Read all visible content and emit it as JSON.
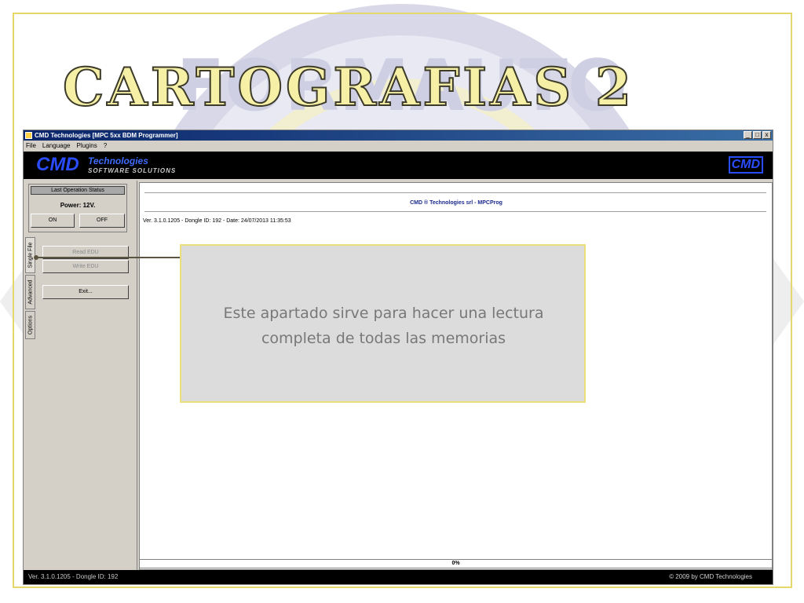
{
  "slide": {
    "title": "CARTOGRAFIAS 2",
    "watermark_text": "FORMAUTO"
  },
  "window": {
    "title": "CMD Technologies [MPC 5xx BDM Programmer]",
    "controls": [
      "_",
      "□",
      "x"
    ]
  },
  "menu": {
    "items": [
      "File",
      "Language",
      "Plugins",
      "?"
    ]
  },
  "banner": {
    "brand": "CMD",
    "technologies": "Technologies",
    "tagline": "SOFTWARE SOLUTIONS",
    "logo_right": "CMD"
  },
  "left_panel": {
    "status_label": "Last Operation Status",
    "power_label": "Power: 12V.",
    "on_button": "ON",
    "off_button": "OFF",
    "tabs": [
      "Single File",
      "Advanced",
      "Options"
    ],
    "read_button": "Read EDU",
    "write_button": "Write EDU",
    "exit_button": "Exit..."
  },
  "main": {
    "header": "CMD ® Technologies srl - MPCProg",
    "version_line": "Ver. 3.1.0.1205 - Dongle ID: 192 - Date: 24/07/2013 11:35:53"
  },
  "progress": {
    "label": "0%",
    "value": 0
  },
  "statusbar": {
    "left": "Ver. 3.1.0.1205 - Dongle ID: 192",
    "right": "© 2009 by CMD Technologies"
  },
  "callout": {
    "text": "Este apartado sirve para hacer una lectura completa de todas las memorias"
  },
  "colors": {
    "frame": "#e4d86a",
    "title_fill": "#f6f0a6",
    "banner_blue": "#2a4cff",
    "callout_bg": "#dcdcdc"
  }
}
